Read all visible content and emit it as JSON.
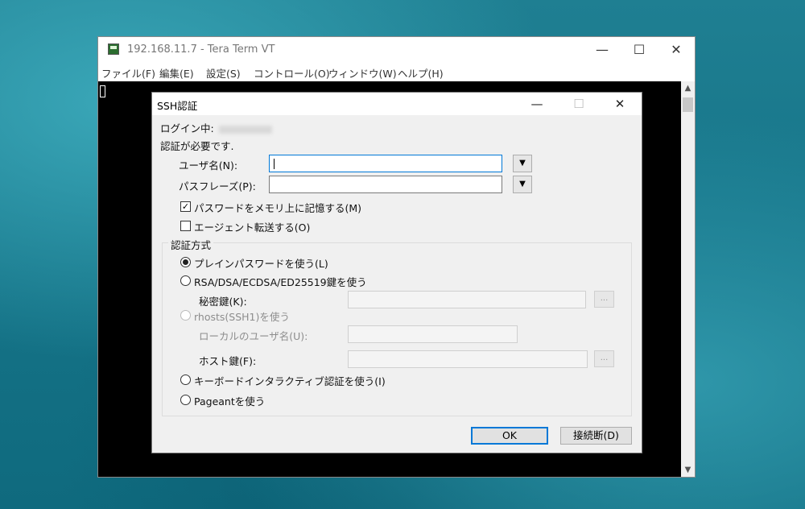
{
  "window": {
    "title": "192.168.11.7 - Tera Term VT",
    "menu": [
      "ファイル(F)",
      "編集(E)",
      "設定(S)",
      "コントロール(O)",
      "ウィンドウ(W)",
      "ヘルプ(H)"
    ],
    "caption": {
      "minimize": "—",
      "maximize": "☐",
      "close": "✕"
    }
  },
  "dialog": {
    "title": "SSH認証",
    "caption": {
      "minimize": "—",
      "maximize": "☐",
      "close": "✕"
    },
    "logging_in_label": "ログイン中:",
    "auth_required": "認証が必要です.",
    "username_label": "ユーザ名(N):",
    "username_value": "",
    "passphrase_label": "パスフレーズ(P):",
    "passphrase_value": "",
    "remember_password_label": "パスワードをメモリ上に記憶する(M)",
    "remember_password_checked": true,
    "agent_forward_label": "エージェント転送する(O)",
    "agent_forward_checked": false,
    "auth_method_group": "認証方式",
    "methods": [
      {
        "label": "プレインパスワードを使う(L)",
        "selected": true,
        "enabled": true
      },
      {
        "label": "RSA/DSA/ECDSA/ED25519鍵を使う",
        "selected": false,
        "enabled": true
      },
      {
        "label": "rhosts(SSH1)を使う",
        "selected": false,
        "enabled": false
      },
      {
        "label": "キーボードインタラクティブ認証を使う(I)",
        "selected": false,
        "enabled": true
      },
      {
        "label": "Pageantを使う",
        "selected": false,
        "enabled": true
      }
    ],
    "private_key_label": "秘密鍵(K):",
    "local_user_label": "ローカルのユーザ名(U):",
    "host_key_label": "ホスト鍵(F):",
    "browse_label": "...",
    "dropdown_arrow": "▼",
    "ok_label": "OK",
    "disconnect_label": "接続断(D)"
  }
}
